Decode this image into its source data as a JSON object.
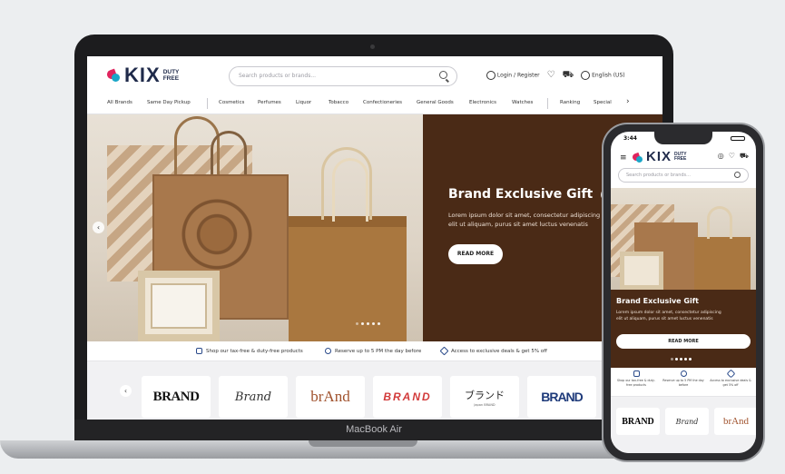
{
  "site": {
    "logo_text": "KIX",
    "logo_sub_1": "DUTY",
    "logo_sub_2": "FREE",
    "search_placeholder": "Search products or brands...",
    "login_label": "Login / Register",
    "language_label": "English (US)"
  },
  "nav": {
    "items": [
      "All Brands",
      "Same Day Pickup",
      "Cosmetics",
      "Perfumes",
      "Liquor",
      "Tobacco",
      "Confectioneries",
      "General Goods",
      "Electronics",
      "Watches",
      "Ranking",
      "Special"
    ],
    "more_label": "›"
  },
  "hero": {
    "title": "Brand Exclusive Gift",
    "text_line1": "Lorem ipsum dolor sit amet, consectetur adipiscing",
    "text_line2": "elit ut aliquam, purus sit amet luctus venenatis",
    "button_label": "READ MORE",
    "prev_label": "‹",
    "slide_count": 5,
    "active_slide": 0
  },
  "features": [
    {
      "label": "Shop our tax-free & duty-free products",
      "icon": "shopping-bag-icon"
    },
    {
      "label": "Reserve up to 5 PM the day before",
      "icon": "clock-icon"
    },
    {
      "label": "Access to exclusive deals & get 5% off",
      "icon": "diamond-icon"
    }
  ],
  "brands": {
    "prev_label": "‹",
    "items": [
      "BRAND",
      "Brand",
      "brAnd",
      "BRAND",
      "ブランド",
      "BRAND"
    ],
    "japanese_sub": "Japan BRAND"
  },
  "device": {
    "laptop_name": "MacBook Air"
  },
  "phone": {
    "time": "3:44",
    "menu_icon": "≡",
    "search_placeholder": "Search products or brands...",
    "hero_title": "Brand Exclusive Gift",
    "hero_text_line1": "Lorem ipsum dolor sit amet, consectetur adipiscing",
    "hero_text_line2": "elit ut aliquam, purus sit amet luctus venenatis",
    "hero_button": "READ MORE",
    "features": [
      "Shop our tax-free & duty-free products",
      "Reserve up to 5 PM the day before",
      "Access to exclusive deals & get 5% off"
    ],
    "brands": [
      "BRAND",
      "Brand",
      "brAnd"
    ]
  },
  "colors": {
    "hero_dark": "#4a2a16",
    "logo_pink": "#e0245e",
    "logo_blue": "#1aa6c8",
    "logo_navy": "#1f2a4a"
  }
}
